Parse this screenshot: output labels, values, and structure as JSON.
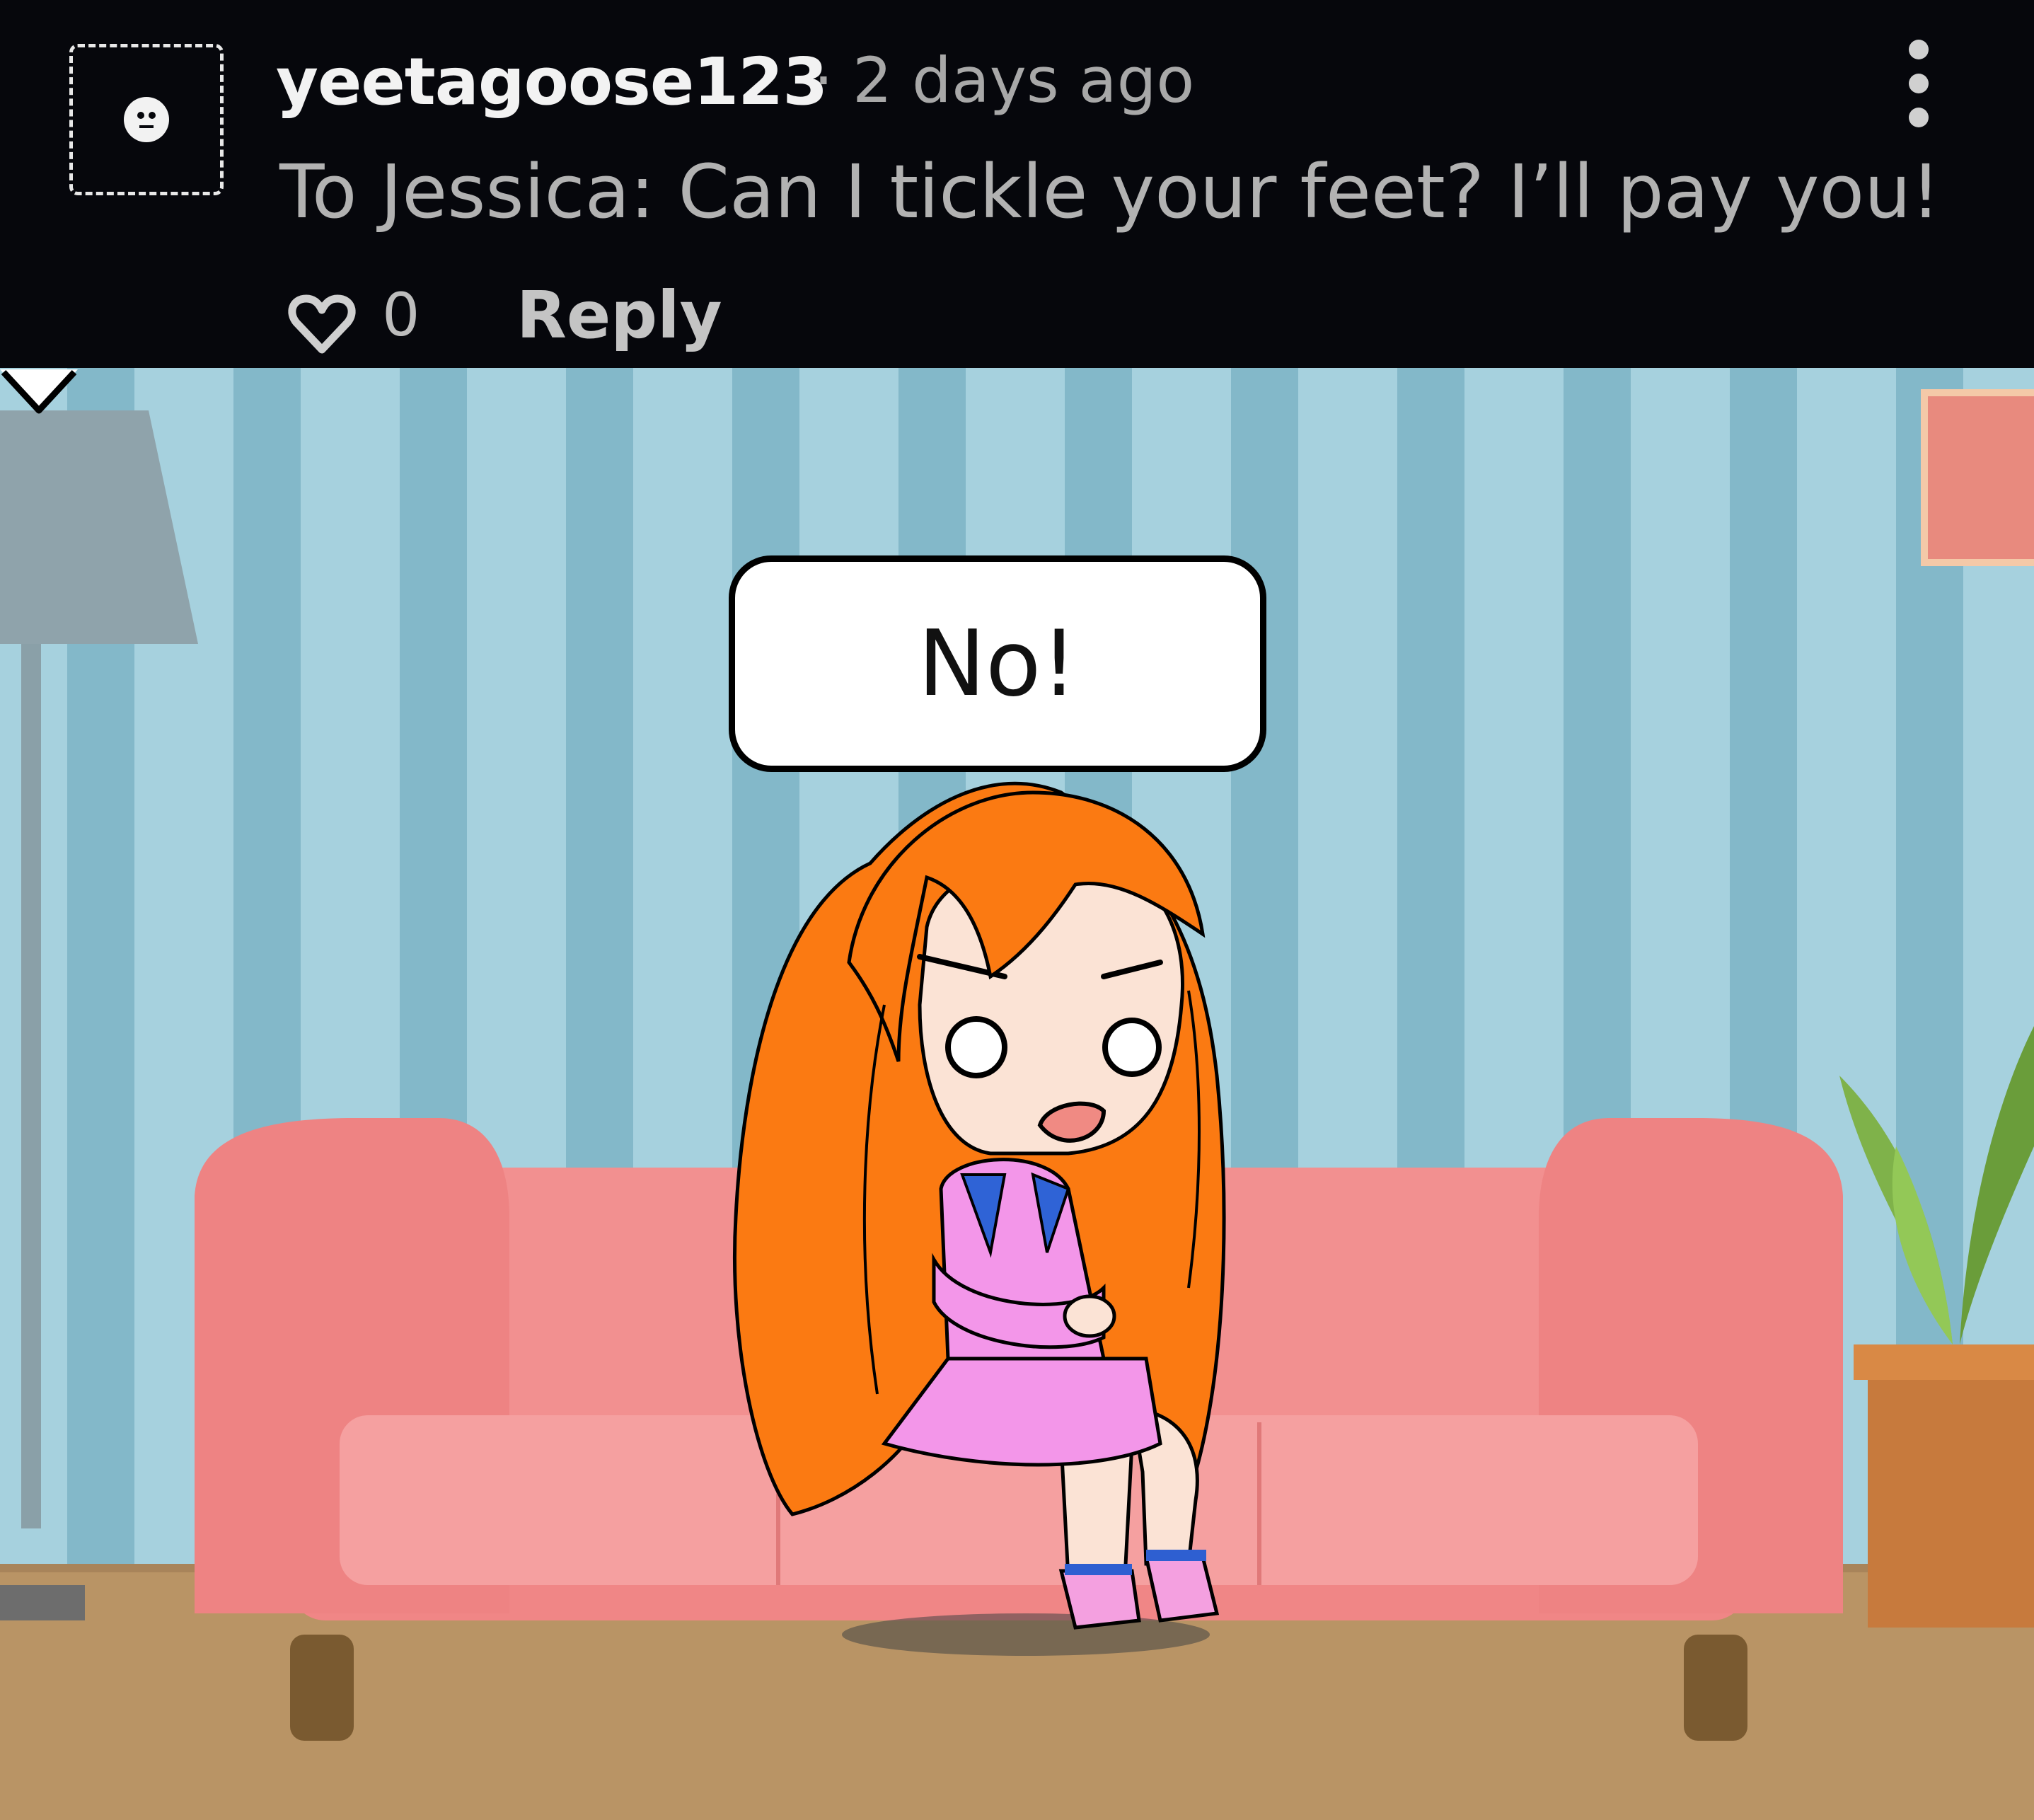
{
  "comment": {
    "avatar_icon": "neutral-face-icon",
    "username": "yeetagoose123",
    "separator": "·",
    "time": "2 days ago",
    "text": "To Jessica: Can I tickle your feet? I’ll pay you!",
    "like_icon": "heart-outline-icon",
    "like_count": "0",
    "reply_label": "Reply",
    "menu_icon": "vertical-ellipsis-icon"
  },
  "scene": {
    "speech_bubble": "No!",
    "colors": {
      "wall_light": "#a6d1de",
      "wall_dark": "#83b8c9",
      "sofa": "#ee8383",
      "floor": "#b99465",
      "hair": "#fb7a12",
      "dress": "#f396e9"
    }
  }
}
